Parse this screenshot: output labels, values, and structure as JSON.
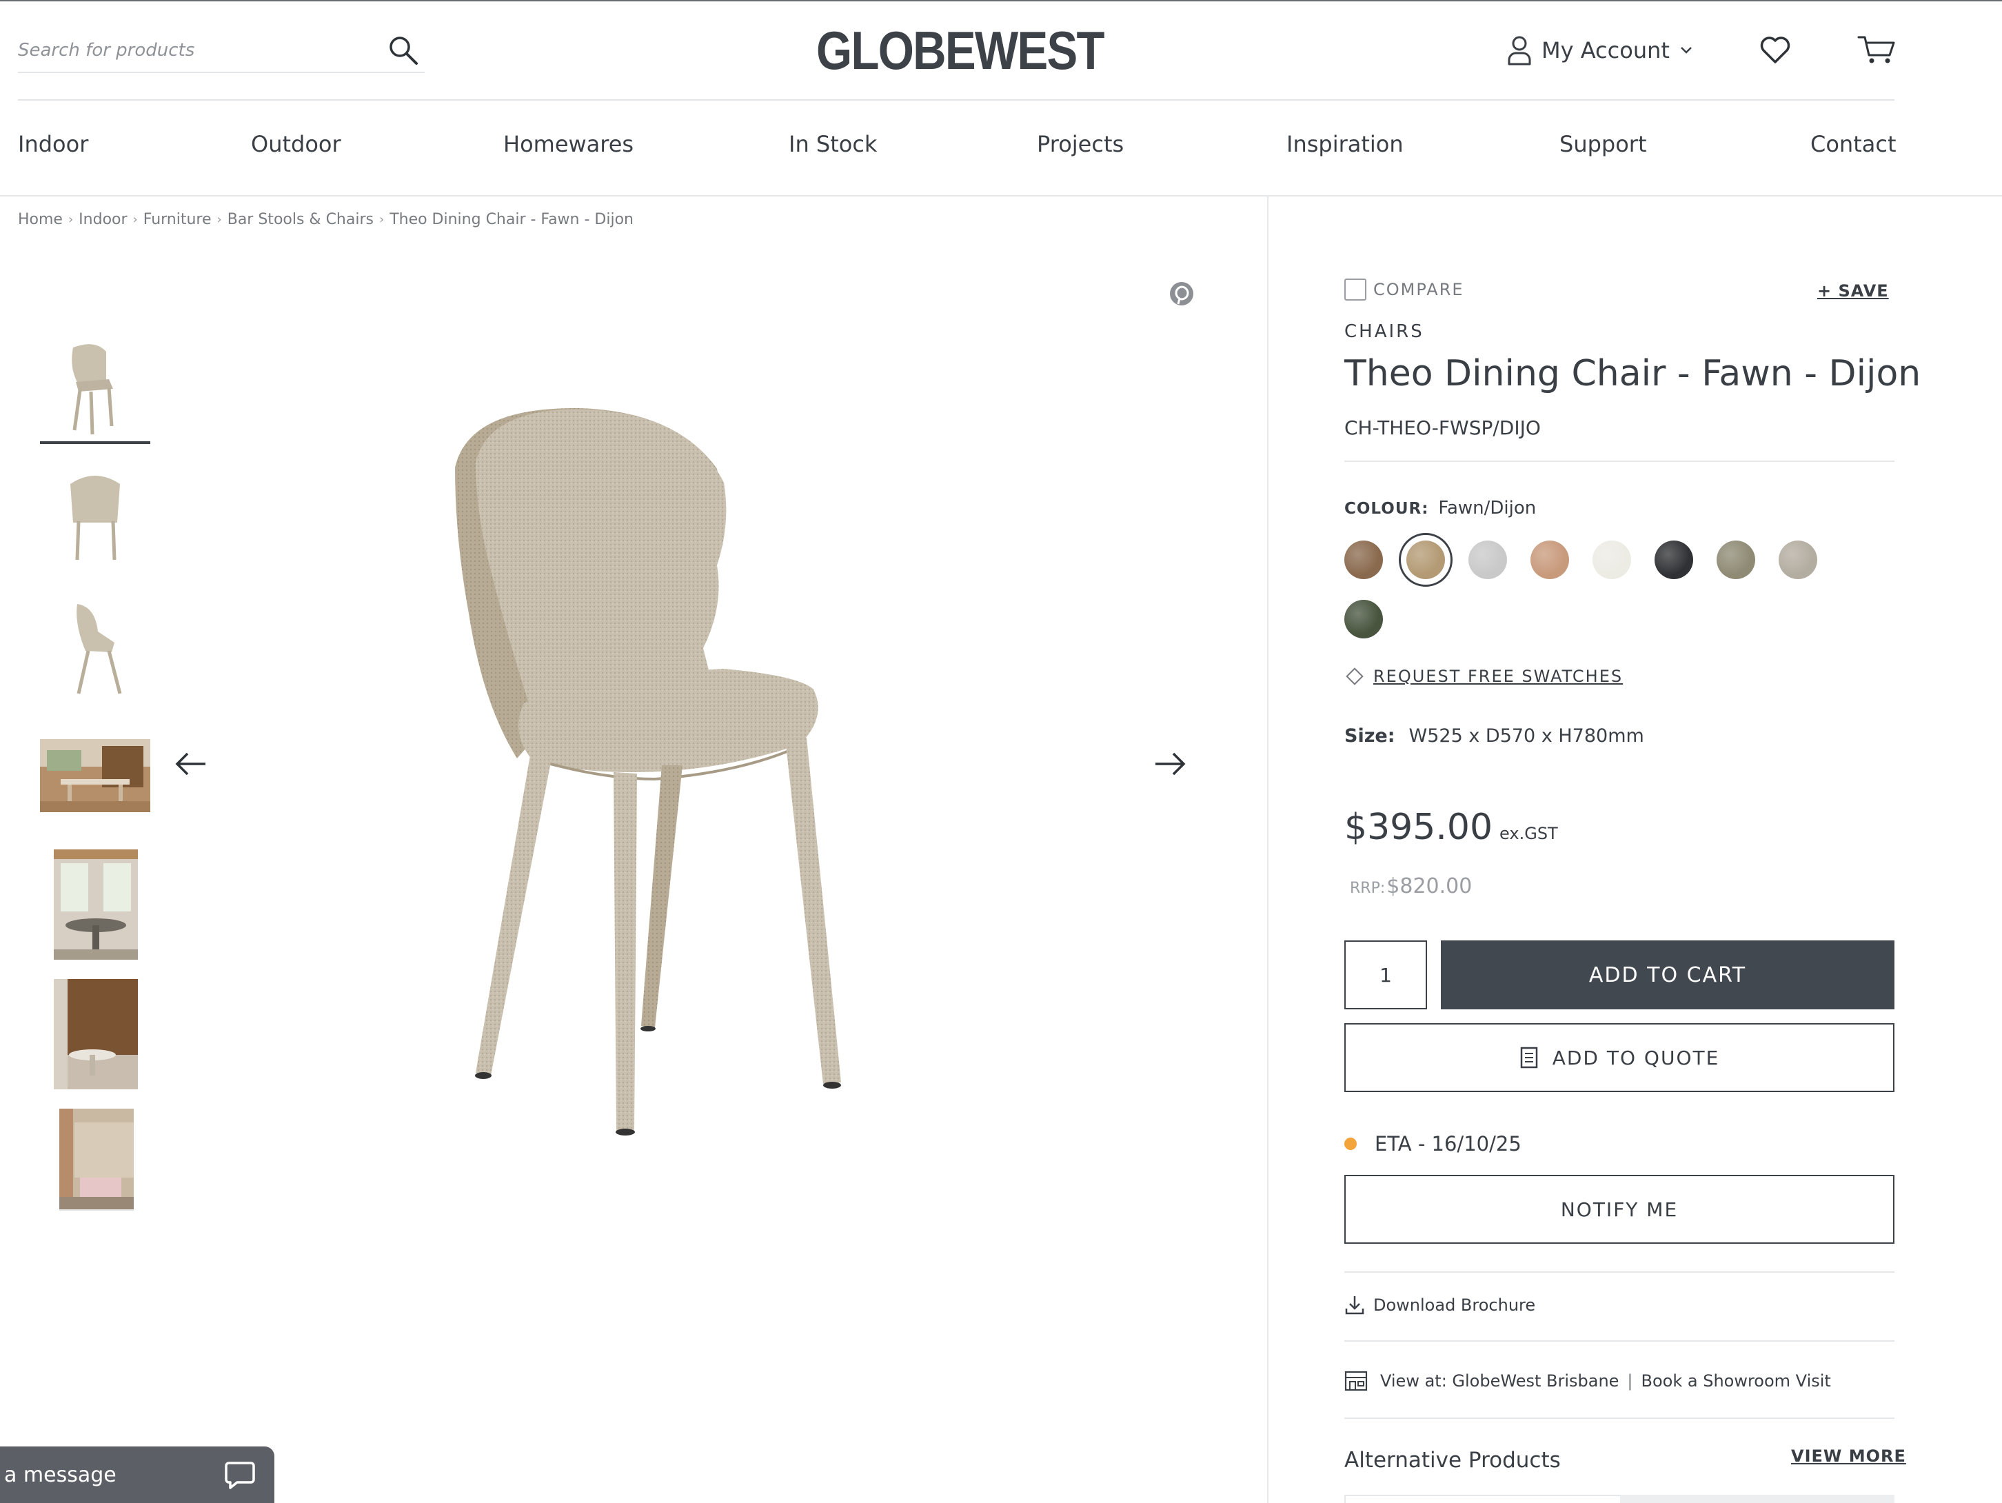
{
  "header": {
    "search_placeholder": "Search for products",
    "logo": "GLOBEWEST",
    "account_label": "My Account"
  },
  "nav": [
    "Indoor",
    "Outdoor",
    "Homewares",
    "In Stock",
    "Projects",
    "Inspiration",
    "Support",
    "Contact"
  ],
  "breadcrumb": [
    "Home",
    "Indoor",
    "Furniture",
    "Bar Stools & Chairs",
    "Theo Dining Chair - Fawn - Dijon"
  ],
  "gallery": {
    "thumbnail_icons": [
      "chair-front-angle",
      "chair-back",
      "chair-side",
      "dining-room-scene",
      "sunroom-scene",
      "timber-wall-scene",
      "stone-wall-scene"
    ]
  },
  "product": {
    "compare_label": "COMPARE",
    "save_label": "+ SAVE",
    "category": "CHAIRS",
    "title": "Theo Dining Chair - Fawn - Dijon",
    "sku": "CH-THEO-FWSP/DIJO",
    "colour_label": "COLOUR:",
    "colour_value": "Fawn/Dijon",
    "swatches": [
      {
        "name": "brown",
        "color": "#8a6a4e"
      },
      {
        "name": "fawn-dijon",
        "color": "#b39a74",
        "selected": true
      },
      {
        "name": "light-grey",
        "color": "#c9c9c9"
      },
      {
        "name": "terracotta",
        "color": "#c89a7c"
      },
      {
        "name": "ivory",
        "color": "#ecebe4"
      },
      {
        "name": "charcoal",
        "color": "#2f3134"
      },
      {
        "name": "olive-grey",
        "color": "#8e8a74"
      },
      {
        "name": "stone",
        "color": "#b3aca0"
      },
      {
        "name": "forest",
        "color": "#48543e"
      }
    ],
    "request_swatches_label": "REQUEST FREE SWATCHES",
    "size_label": "Size:",
    "size_value": "W525 x D570 x H780mm",
    "price": "$395.00",
    "price_suffix": "ex.GST",
    "rrp_label": "RRP:",
    "rrp_value": "$820.00",
    "quantity": "1",
    "add_to_cart_label": "ADD TO CART",
    "add_to_quote_label": "ADD TO QUOTE",
    "eta": "ETA - 16/10/25",
    "eta_color": "#f3a43b",
    "notify_label": "NOTIFY ME",
    "download_label": "Download Brochure",
    "view_at_label": "View at: GlobeWest Brisbane",
    "book_visit_label": "Book a Showroom Visit",
    "alternative_title": "Alternative Products",
    "view_more_label": "VIEW MORE"
  },
  "chat": {
    "label": "a message"
  },
  "colors": {
    "primary_button": "#414850",
    "text": "#3a3f45"
  }
}
